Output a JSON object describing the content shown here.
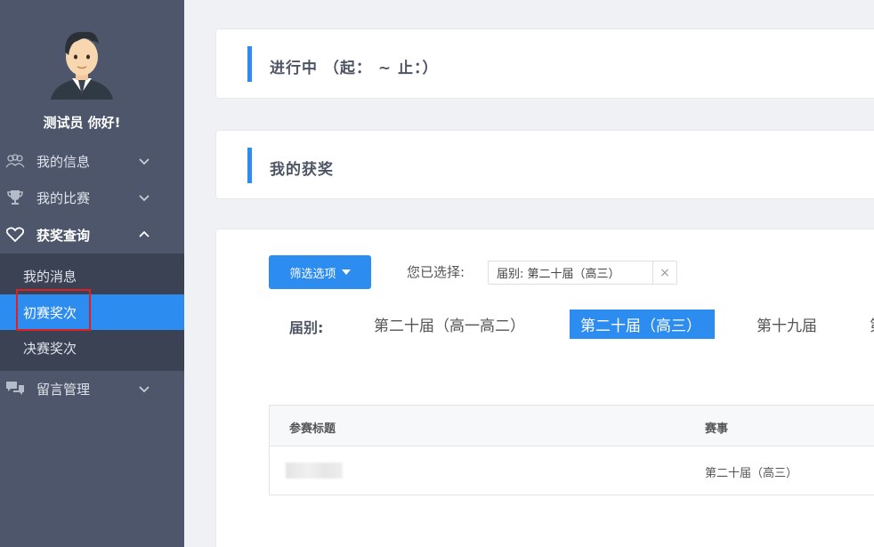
{
  "sidebar": {
    "greeting": "测试员 你好!",
    "items": [
      {
        "label": "我的信息",
        "icon": "users-icon"
      },
      {
        "label": "我的比赛",
        "icon": "trophy-icon"
      },
      {
        "label": "获奖查询",
        "icon": "heart-icon",
        "expanded": true
      },
      {
        "label": "留言管理",
        "icon": "chat-icon"
      }
    ],
    "submenu": [
      {
        "label": "我的消息"
      },
      {
        "label": "初赛奖次",
        "selected": true
      },
      {
        "label": "决赛奖次"
      }
    ]
  },
  "main": {
    "ongoing_title": "进行中 （起： ~ 止：）",
    "awards_title": "我的获奖",
    "filter": {
      "button_label": "筛选选项",
      "selected_label": "您已选择:",
      "tag_text": "届别: 第二十届（高三）",
      "tag_close": "×",
      "row_label": "届别:",
      "options": [
        {
          "label": "第二十届（高一高二）"
        },
        {
          "label": "第二十届（高三）",
          "active": true
        },
        {
          "label": "第十九届"
        },
        {
          "label": "第"
        }
      ]
    },
    "table": {
      "headers": [
        "参赛标题",
        "赛事"
      ],
      "rows": [
        {
          "title": "",
          "event": "第二十届（高三）"
        }
      ]
    }
  },
  "colors": {
    "accent": "#2d8cf0",
    "sidebar_bg": "#4d566b",
    "submenu_bg": "#3a4254",
    "highlight_box": "#e02020"
  }
}
